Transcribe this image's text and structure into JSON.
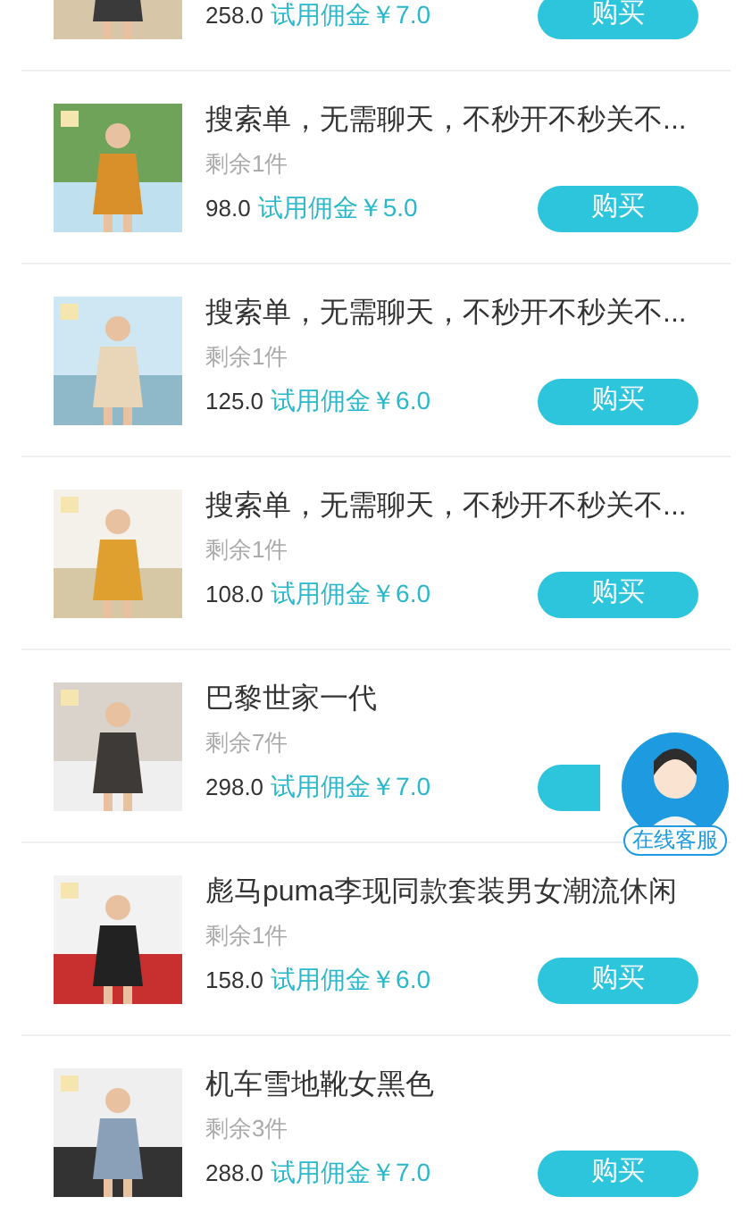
{
  "products": [
    {
      "kind": "partial",
      "price": "258.0",
      "commission": "试用佣金￥7.0",
      "button": "购买"
    },
    {
      "kind": "full",
      "title": "搜索单，无需聊天，不秒开不秒关不...",
      "remaining": "剩余1件",
      "price": "98.0",
      "commission": "试用佣金￥5.0",
      "button": "购买"
    },
    {
      "kind": "full",
      "title": "搜索单，无需聊天，不秒开不秒关不...",
      "remaining": "剩余1件",
      "price": "125.0",
      "commission": "试用佣金￥6.0",
      "button": "购买"
    },
    {
      "kind": "full",
      "title": "搜索单，无需聊天，不秒开不秒关不...",
      "remaining": "剩余1件",
      "price": "108.0",
      "commission": "试用佣金￥6.0",
      "button": "购买"
    },
    {
      "kind": "full",
      "title": "巴黎世家一代",
      "remaining": "剩余7件",
      "price": "298.0",
      "commission": "试用佣金￥7.0"
    },
    {
      "kind": "full",
      "title": "彪马puma李现同款套装男女潮流休闲",
      "remaining": "剩余1件",
      "price": "158.0",
      "commission": "试用佣金￥6.0",
      "button": "购买"
    },
    {
      "kind": "full",
      "title": "机车雪地靴女黑色",
      "remaining": "剩余3件",
      "price": "288.0",
      "commission": "试用佣金￥7.0",
      "button": "购买"
    }
  ],
  "support": {
    "label": "在线客服"
  }
}
